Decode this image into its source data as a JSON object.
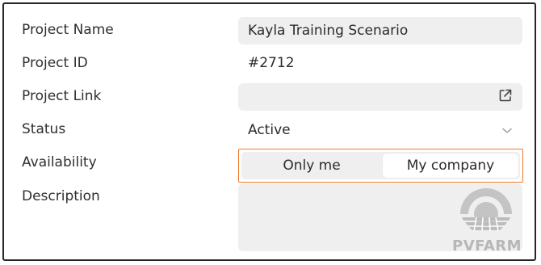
{
  "form": {
    "project_name": {
      "label": "Project Name",
      "value": "Kayla Training Scenario"
    },
    "project_id": {
      "label": "Project ID",
      "value": "#2712"
    },
    "project_link": {
      "label": "Project Link",
      "value": "",
      "icon": "external-link-icon"
    },
    "status": {
      "label": "Status",
      "value": "Active",
      "icon": "chevron-down-icon"
    },
    "availability": {
      "label": "Availability",
      "options": [
        "Only me",
        "My company"
      ],
      "selected": "My company",
      "accent_color": "#f0792a"
    },
    "description": {
      "label": "Description",
      "value": ""
    }
  },
  "watermark": {
    "text": "PVFARM"
  }
}
